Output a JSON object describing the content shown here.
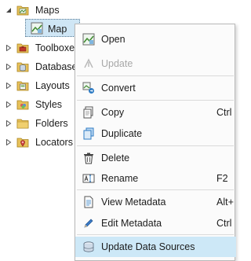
{
  "tree": {
    "maps_label": "Maps",
    "map_label": "Map",
    "toolboxes_label": "Toolboxes",
    "databases_label": "Databases",
    "layouts_label": "Layouts",
    "styles_label": "Styles",
    "folders_label": "Folders",
    "locators_label": "Locators"
  },
  "context_menu": {
    "open": "Open",
    "update": "Update",
    "convert": "Convert",
    "copy": "Copy",
    "copy_shortcut": "Ctrl",
    "duplicate": "Duplicate",
    "delete": "Delete",
    "rename": "Rename",
    "rename_shortcut": "F2",
    "view_metadata": "View Metadata",
    "view_metadata_shortcut": "Alt+",
    "edit_metadata": "Edit Metadata",
    "edit_metadata_shortcut": "Ctrl",
    "update_data_sources": "Update Data Sources"
  },
  "colors": {
    "selection_bg": "#cfe6f5",
    "hover_bg": "#cde8f7",
    "folder_yellow": "#e8c15a",
    "icon_blue": "#2f7cc4"
  }
}
